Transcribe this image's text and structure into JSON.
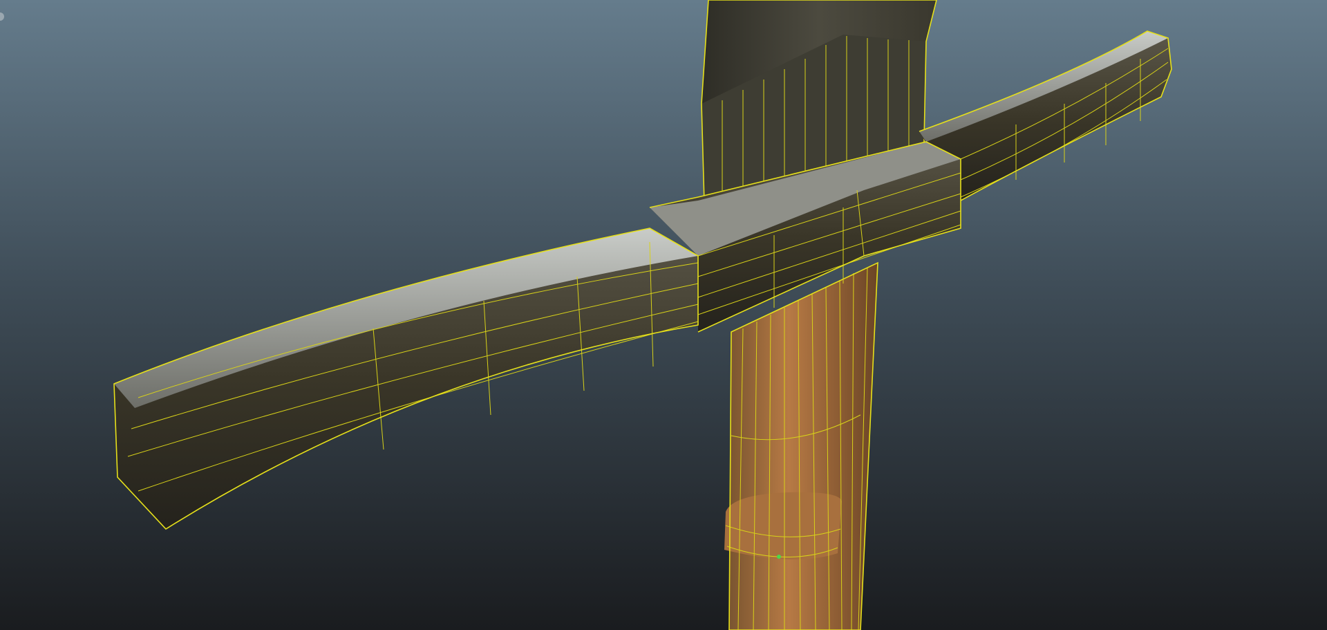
{
  "viewport": {
    "background_top": "#647b8b",
    "background_bottom": "#1b1d20",
    "wireframe_color": "#e6e01a",
    "selected_vertex_color": "#4cd84c"
  }
}
